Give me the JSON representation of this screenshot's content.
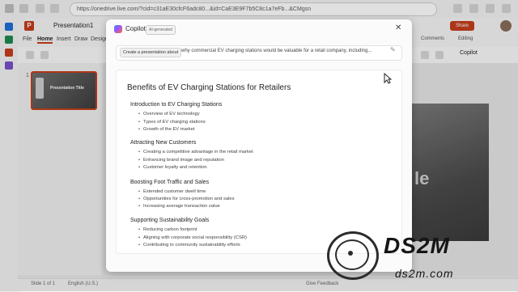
{
  "browser": {
    "url": "https://onedrive.live.com/?cid=c31aE30cfcF6adc80...&id=CaE3E9F7b5C8c1a7eFb...&CMgsn"
  },
  "ppt": {
    "doc_title": "Presentation1",
    "tabs": [
      "File",
      "Home",
      "Insert",
      "Draw",
      "Design"
    ],
    "active_tab": "Home",
    "share_label": "Share",
    "editing_label": "Editing",
    "comments_label": "Comments",
    "copilot_label": "Copilot",
    "slide_number": "1",
    "thumb_title": "Presentation Title",
    "slide_glyph": "le",
    "status_left": "Slide 1 of 1",
    "status_lang": "English (U.S.)",
    "status_right": "Give Feedback"
  },
  "copilot": {
    "title": "Copilot",
    "badge": "AI-generated",
    "prompt_chip": "Create a presentation about",
    "prompt_text": "why commercial EV charging stations would be valuable for a retail company, including...",
    "outline_title": "Benefits of EV Charging Stations for Retailers",
    "sections": [
      {
        "heading": "Introduction to EV Charging Stations",
        "items": [
          "Overview of EV technology",
          "Types of EV charging stations",
          "Growth of the EV market"
        ]
      },
      {
        "heading": "Attracting New Customers",
        "items": [
          "Creating a competitive advantage in the retail market",
          "Enhancing brand image and reputation",
          "Customer loyalty and retention"
        ]
      },
      {
        "heading": "Boosting Foot Traffic and Sales",
        "items": [
          "Extended customer dwell time",
          "Opportunities for cross-promotion and sales",
          "Increasing average transaction value"
        ]
      },
      {
        "heading": "Supporting Sustainability Goals",
        "items": [
          "Reducing carbon footprint",
          "Aligning with corporate social responsibility (CSR)",
          "Contributing to community sustainability efforts"
        ]
      }
    ]
  },
  "watermark": {
    "logo_text": "DS2M",
    "domain": "ds2m.com"
  }
}
